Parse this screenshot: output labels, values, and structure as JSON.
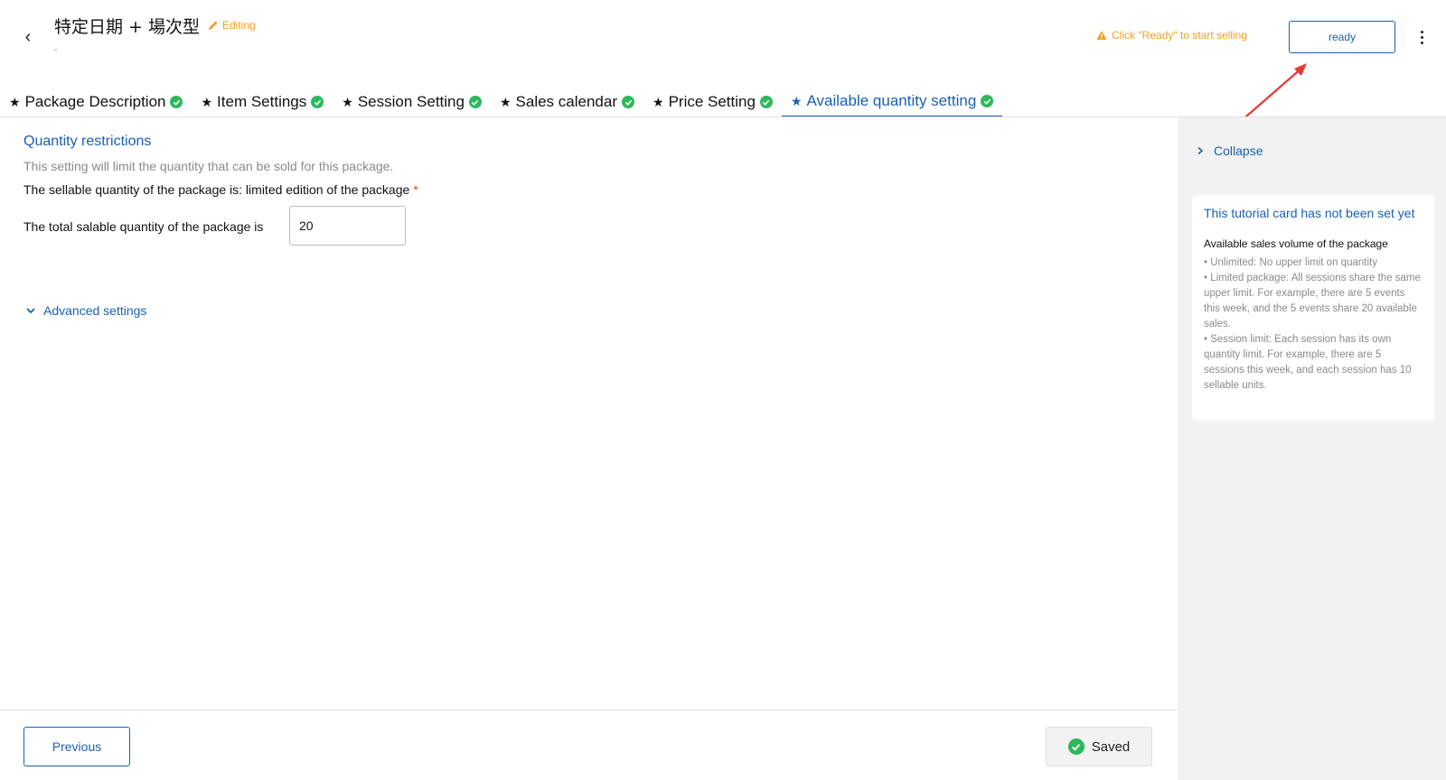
{
  "header": {
    "back_icon": "chevron-left-icon",
    "title": "特定日期 + 場次型",
    "editing_label": "Editing",
    "subtitle": "-",
    "warning_text": "Click \"Ready\" to start selling",
    "ready_label": "ready",
    "accent_color": "#1a5fb4",
    "warning_color": "#f0a020"
  },
  "tabs": [
    {
      "label": "Package Description"
    },
    {
      "label": "Item Settings"
    },
    {
      "label": "Session Setting"
    },
    {
      "label": "Sales calendar"
    },
    {
      "label": "Price Setting"
    },
    {
      "label": "Available quantity setting"
    }
  ],
  "active_tab": "Available quantity setting",
  "main": {
    "section_title": "Quantity restrictions",
    "section_desc": "This setting will limit the quantity that can be sold for this package.",
    "sellable_line": "The sellable quantity of the package is: limited edition of the package",
    "required_mark": "*",
    "total_label": "The total salable quantity of the package is",
    "total_value": "20",
    "advanced_label": "Advanced settings"
  },
  "footer": {
    "previous_label": "Previous",
    "saved_label": "Saved",
    "success_color": "#2eb85c"
  },
  "panel": {
    "collapse_label": "Collapse",
    "card_title": "This tutorial card has not been set yet",
    "card_subtitle": "Available sales volume of the package",
    "card_items": [
      "• Unlimited: No upper limit on quantity",
      "• Limited package: All sessions share the same upper limit. For example, there are 5 events this week, and the 5 events share 20 available sales.",
      "• Session limit: Each session has its own quantity limit. For example, there are 5 sessions this week, and each session has 10 sellable units."
    ]
  }
}
